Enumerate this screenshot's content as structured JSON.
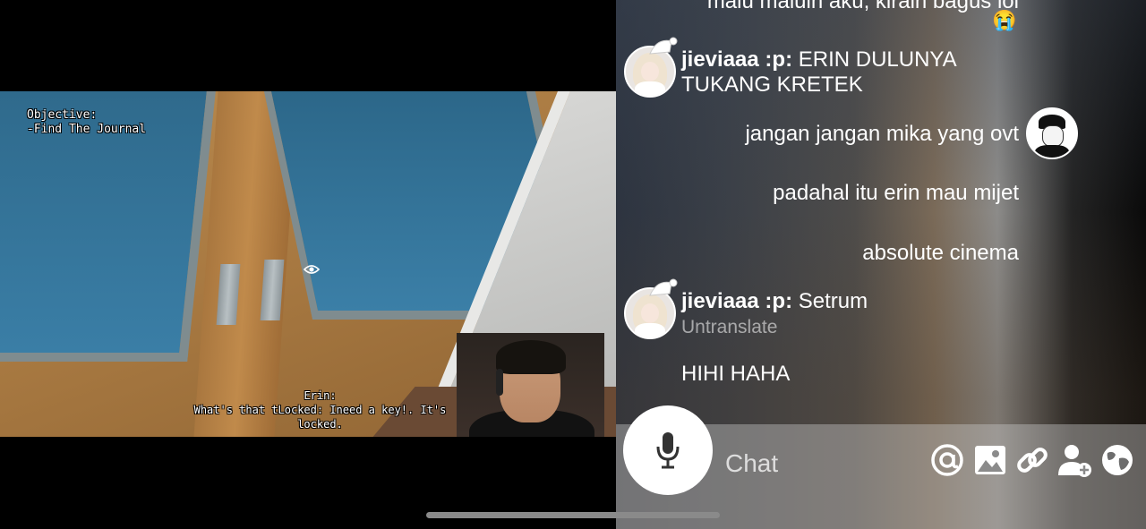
{
  "video": {
    "objective_title": "Objective:",
    "objective_task": "-Find The Journal",
    "subtitle_speaker": "Erin:",
    "subtitle_line": "What's that tLocked: Ineed a key!. It's locked."
  },
  "chat": {
    "messages": [
      {
        "text": "malu maluin aku, kirain bagus lol",
        "emoji": "😭"
      },
      {
        "username": "jieviaaa :p:",
        "text": "ERIN DULUNYA",
        "text_line2": "TUKANG KRETEK"
      },
      {
        "text": "jangan jangan mika yang ovt"
      },
      {
        "text": "padahal itu erin mau mijet"
      },
      {
        "text": "absolute cinema"
      },
      {
        "username": "jieviaaa :p:",
        "text": "Setrum",
        "subtext": "Untranslate"
      },
      {
        "text": "HIHI HAHA"
      }
    ],
    "input_placeholder": "Chat",
    "tools": [
      "mention-icon",
      "image-icon",
      "link-icon",
      "add-user-icon",
      "globe-icon"
    ]
  }
}
